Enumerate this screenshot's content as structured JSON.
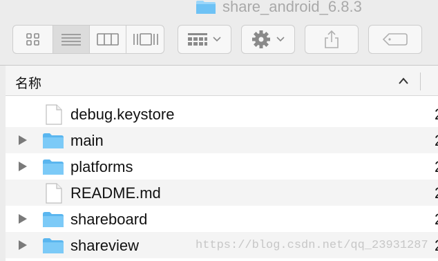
{
  "window": {
    "title": "share_android_6.8.3",
    "title_icon": "folder-icon"
  },
  "toolbar": {
    "view_modes": [
      {
        "name": "icon-view",
        "icon": "grid-icon",
        "active": false
      },
      {
        "name": "list-view",
        "icon": "list-icon",
        "active": true
      },
      {
        "name": "column-view",
        "icon": "columns-icon",
        "active": false
      },
      {
        "name": "gallery-view",
        "icon": "gallery-icon",
        "active": false
      }
    ],
    "arrange_icon": "arrange-icon",
    "action_icon": "gear-icon",
    "share_icon": "share-icon",
    "tags_icon": "tag-icon"
  },
  "columns": {
    "name_label": "名称",
    "sort": "ascending"
  },
  "rows": [
    {
      "name": "debug.keystore",
      "kind": "file",
      "expandable": false,
      "date": "2"
    },
    {
      "name": "main",
      "kind": "folder",
      "expandable": true,
      "date": "2"
    },
    {
      "name": "platforms",
      "kind": "folder",
      "expandable": true,
      "date": "2"
    },
    {
      "name": "README.md",
      "kind": "file",
      "expandable": false,
      "date": "2"
    },
    {
      "name": "shareboard",
      "kind": "folder",
      "expandable": true,
      "date": "2"
    },
    {
      "name": "shareview",
      "kind": "folder",
      "expandable": true,
      "date": "2"
    }
  ],
  "watermark": "https://blog.csdn.net/qq_23931287",
  "colors": {
    "folder": "#6ec2f5",
    "folder_tab": "#9ad6fa",
    "toolbar_icon": "#8a8a8a",
    "row_alt": "#f4f4f4"
  }
}
